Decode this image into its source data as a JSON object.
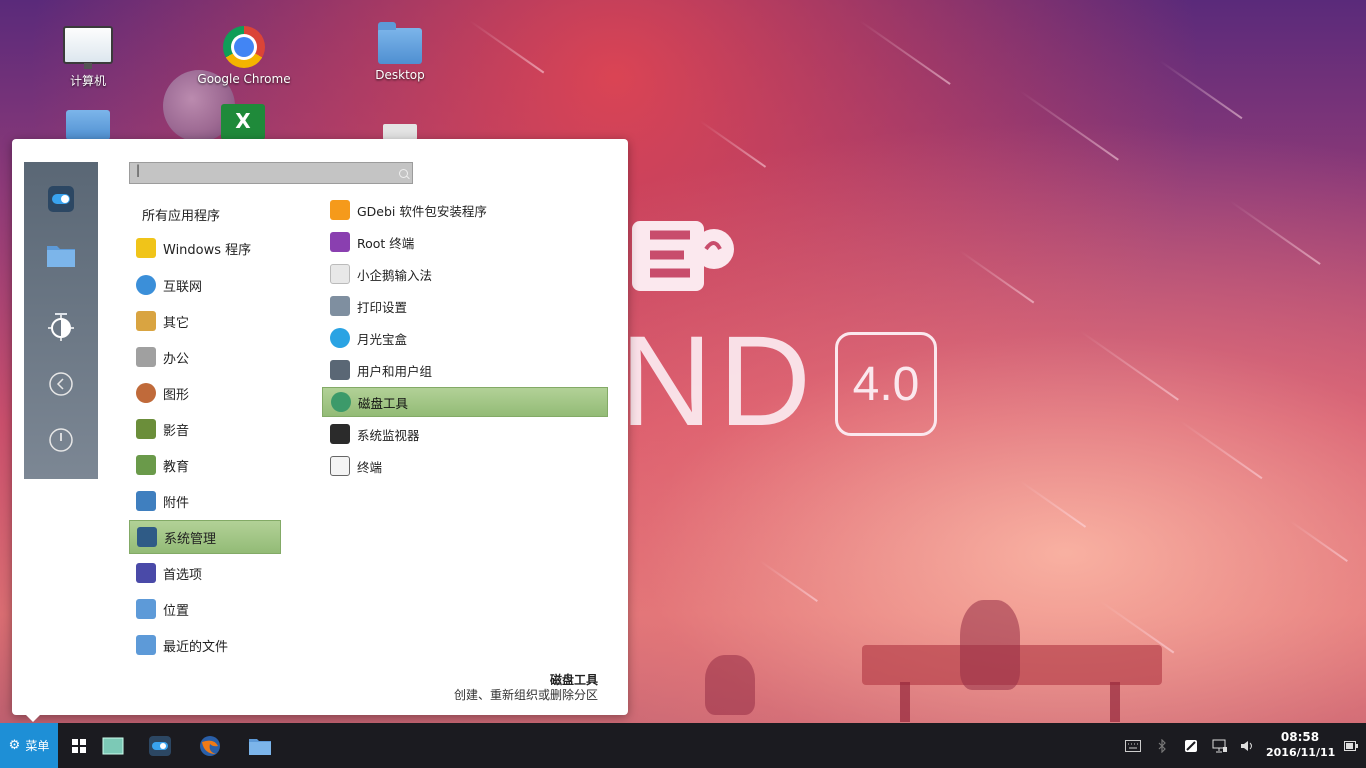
{
  "desktop": {
    "icons": [
      {
        "label": "计算机",
        "icon": "computer-icon"
      },
      {
        "label": "Google Chrome",
        "icon": "chrome-icon"
      },
      {
        "label": "Desktop",
        "icon": "folder-icon"
      }
    ],
    "wallpaper": {
      "version": "4.0"
    }
  },
  "menu": {
    "search": {
      "value": "|",
      "placeholder": ""
    },
    "sidebar": [
      "system-settings-icon",
      "folder-icon",
      "brightness-icon",
      "back-icon",
      "power-icon"
    ],
    "all_apps_label": "所有应用程序",
    "categories": [
      {
        "label": "Windows 程序",
        "icon": "wine-icon",
        "color": "#f0c419"
      },
      {
        "label": "互联网",
        "icon": "globe-icon",
        "color": "#3b8fd9"
      },
      {
        "label": "其它",
        "icon": "misc-icon",
        "color": "#d9a441"
      },
      {
        "label": "办公",
        "icon": "office-icon",
        "color": "#a0a0a0"
      },
      {
        "label": "图形",
        "icon": "graphics-icon",
        "color": "#c06a3a"
      },
      {
        "label": "影音",
        "icon": "multimedia-icon",
        "color": "#6b8e3a"
      },
      {
        "label": "教育",
        "icon": "education-icon",
        "color": "#6a9a4a"
      },
      {
        "label": "附件",
        "icon": "accessories-icon",
        "color": "#3f7fbf"
      },
      {
        "label": "系统管理",
        "icon": "system-admin-icon",
        "color": "#2f5b86",
        "selected": true
      },
      {
        "label": "首选项",
        "icon": "preferences-icon",
        "color": "#4a4aa8"
      },
      {
        "label": "位置",
        "icon": "places-icon",
        "color": "#5d9ad8"
      },
      {
        "label": "最近的文件",
        "icon": "recent-files-icon",
        "color": "#5d9ad8"
      }
    ],
    "apps": [
      {
        "label": "GDebi 软件包安装程序",
        "icon": "gdebi-icon",
        "color": "#f59a1b"
      },
      {
        "label": "Root 终端",
        "icon": "root-terminal-icon",
        "color": "#8a3fb0"
      },
      {
        "label": "小企鹅输入法",
        "icon": "fcitx-icon",
        "color": "#e8e8e8"
      },
      {
        "label": "打印设置",
        "icon": "printer-icon",
        "color": "#7f8fa0"
      },
      {
        "label": "月光宝盒",
        "icon": "backup-icon",
        "color": "#2aa3e3"
      },
      {
        "label": "用户和用户组",
        "icon": "users-icon",
        "color": "#5a6775"
      },
      {
        "label": "磁盘工具",
        "icon": "disk-icon",
        "color": "#3c9a6a",
        "selected": true
      },
      {
        "label": "系统监视器",
        "icon": "system-monitor-icon",
        "color": "#2b2b2b"
      },
      {
        "label": "终端",
        "icon": "terminal-icon",
        "color": "#f4f4f4"
      }
    ],
    "description": {
      "title": "磁盘工具",
      "text": "创建、重新组织或删除分区"
    }
  },
  "taskbar": {
    "start_label": "菜单",
    "clock": {
      "time": "08:58",
      "date": "2016/11/11"
    }
  }
}
